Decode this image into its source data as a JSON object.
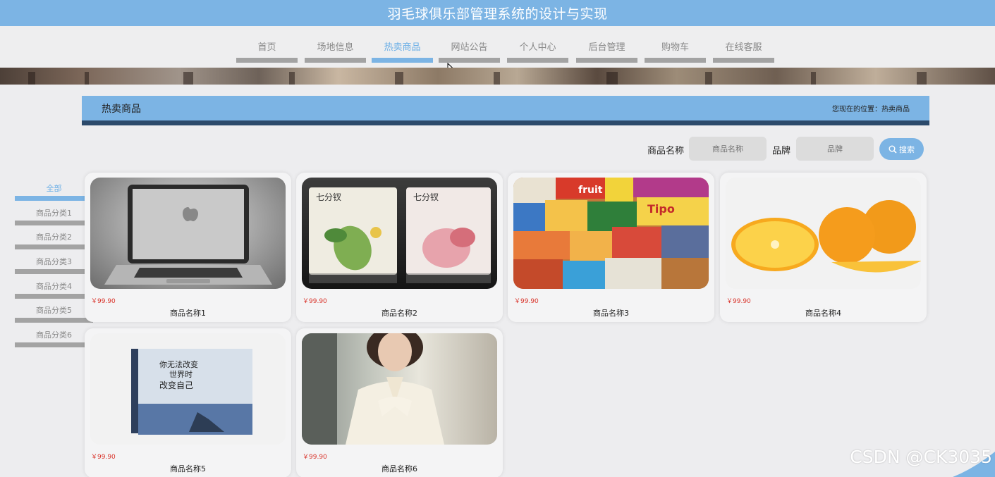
{
  "header": {
    "title": "羽毛球俱乐部管理系统的设计与实现"
  },
  "nav": {
    "items": [
      {
        "label": "首页"
      },
      {
        "label": "场地信息"
      },
      {
        "label": "热卖商品"
      },
      {
        "label": "网站公告"
      },
      {
        "label": "个人中心"
      },
      {
        "label": "后台管理"
      },
      {
        "label": "购物车"
      },
      {
        "label": "在线客服"
      }
    ],
    "active": "热卖商品",
    "colors": {
      "active": "#7cb4e4",
      "inactive_bar": "#a3a3a3"
    }
  },
  "section": {
    "title": "热卖商品",
    "breadcrumb": "您现在的位置：热卖商品",
    "header_color": "#7cb4e4",
    "header_border_color": "#2c4a6b"
  },
  "search": {
    "name_label": "商品名称",
    "name_placeholder": "商品名称",
    "brand_label": "品牌",
    "brand_placeholder": "品牌",
    "button_label": "搜索",
    "button_icon": "search-icon"
  },
  "categories": {
    "items": [
      {
        "label": "全部"
      },
      {
        "label": "商品分类1"
      },
      {
        "label": "商品分类2"
      },
      {
        "label": "商品分类3"
      },
      {
        "label": "商品分类4"
      },
      {
        "label": "商品分类5"
      },
      {
        "label": "商品分类6"
      }
    ],
    "active": "全部"
  },
  "products": [
    {
      "name": "商品名称1",
      "price": "￥99.90",
      "image": "laptop"
    },
    {
      "name": "商品名称2",
      "price": "￥99.90",
      "image": "face-mask-packs"
    },
    {
      "name": "商品名称3",
      "price": "￥99.90",
      "image": "snack-assortment"
    },
    {
      "name": "商品名称4",
      "price": "￥99.90",
      "image": "oranges"
    },
    {
      "name": "商品名称5",
      "price": "￥99.90",
      "image": "book"
    },
    {
      "name": "商品名称6",
      "price": "￥99.90",
      "image": "woman-blouse"
    }
  ],
  "watermark": {
    "text": "CSDN @CK3035"
  },
  "package_texts": {
    "brand": "七分钗"
  },
  "book_texts": {
    "line1": "你无法改变",
    "line2": "世界时",
    "line3": "改变自己"
  },
  "snack_texts": {
    "fruit": "fruit",
    "tipo": "Tipo"
  }
}
